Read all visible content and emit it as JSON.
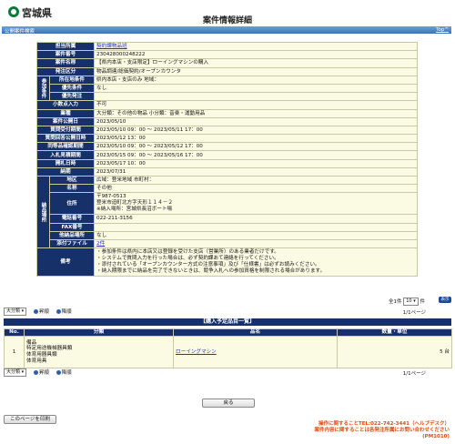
{
  "header": {
    "logo_text": "宮城県",
    "title": "案件情報詳細"
  },
  "section": {
    "label": "公開案件検索",
    "top_link": "Top"
  },
  "detail": {
    "tantou_shozoku_label": "担当所属",
    "tantou_shozoku": "契約課物品班",
    "anken_bangou_label": "案件番号",
    "anken_bangou": "230428000248222",
    "anken_mei_label": "案件名称",
    "anken_mei": "【県内本店・支店限定】ローイングマシンの購入",
    "hacchu_kubun_label": "発注区分",
    "hacchu_kubun": "物品調達/総価契約/オープンカウンタ",
    "sanka_jouken_label": "参加条件",
    "shozai_jouken_label": "所在地条件",
    "shozai_jouken": "県内本店・支店のみ 地域：",
    "yusen_jouken_label": "優先条件",
    "yusen_jouken": "なし",
    "yusen_hacchu_label": "優先発注",
    "yusen_hacchu": "",
    "shousuuten_label": "小数点入力",
    "shousuuten": "不可",
    "gyoushu_label": "業種",
    "gyoushu": "大分類：その他の物品 小分類：音楽・運動用品",
    "koukai_bi_label": "案件公開日",
    "koukai_bi": "2023/05/10",
    "shitsumon_kikan_label": "質問受付期間",
    "shitsumon_kikan": "2023/05/10 09：00 〜 2023/05/11 17：00",
    "shitsumon_kaitou_label": "質問回答公開日時",
    "shitsumon_kaitou": "2023/05/12 13：00",
    "douto_kakunin_label": "同等品確認期間",
    "douto_kakunin": "2023/05/10 09：00 〜 2023/05/12 17：00",
    "nyusatsu_kikan_label": "入札見積期間",
    "nyusatsu_kikan": "2023/05/15 09：00 〜 2023/05/16 17：00",
    "kaisatsu_label": "開札日時",
    "kaisatsu": "2023/05/17 10：00",
    "nouki_label": "納期",
    "nouki": "2023/07/31",
    "nouhin_basho_label": "納品場所",
    "chiku_label": "地区",
    "chiku": "広域：登米地域 市町村：",
    "meishou_label": "名称",
    "meishou": "その他",
    "juusho_label": "住所",
    "juusho_1": "〒987-0513",
    "juusho_2": "登米市迫町北方字天形１１４－２",
    "juusho_3": "※納入場所：宮城県長沼ボート場",
    "denwa_label": "電話番号",
    "denwa": "022-211-3156",
    "fax_label": "FAX番号",
    "fax": "",
    "ta_nouhin_label": "他納品場所",
    "ta_nouhin": "なし",
    "tenpu_label": "添付ファイル",
    "tenpu": "2件",
    "bikou_label": "備考",
    "bikou_1": "・参加条件は県内に本店又は登録を受けた支店（営業所）のある業者だけです。",
    "bikou_2": "・システムで質問入力を行った場合は、必ず契約課あて連絡を行ってください。",
    "bikou_3": "・添付されている「オープンカウンター方式の注意事項」及び「仕様書」は必ずお読みください。",
    "bikou_4": "・納入期限までに納品を完了できないときは、競争入札への参加資格を制限される場合があります。"
  },
  "list_controls": {
    "count_prefix": "全1件",
    "per_page": "10",
    "count_suffix": "件",
    "go_label": "表示",
    "sort_select": "大分類",
    "asc_label": "昇順",
    "desc_label": "降順",
    "page_info": "1/1ページ"
  },
  "plan": {
    "title": "【購入予定品目一覧】",
    "headers": [
      "No.",
      "分類",
      "品名",
      "数量・単位"
    ],
    "rows": [
      {
        "no": "1",
        "class_1": "備品",
        "class_2": "特定用途機械器具類",
        "class_3": "体育用器具類",
        "class_4": "体育用具",
        "item": "ローイングマシン",
        "qty": "5 台"
      }
    ]
  },
  "buttons": {
    "back": "戻る",
    "print": "このページを印刷"
  },
  "contact": {
    "line_1": "操作に関することTEL:022-742-3441（ヘルプデスク）",
    "line_2": "案件内容に関することは各発注所属にお問い合わせください",
    "line_3": "(PM1010)"
  },
  "colors": {
    "header_navy": "#16306a",
    "cell_cream": "#fbfbe4",
    "section_blue": "#3f72b5",
    "contact_orange": "#e04a10"
  }
}
